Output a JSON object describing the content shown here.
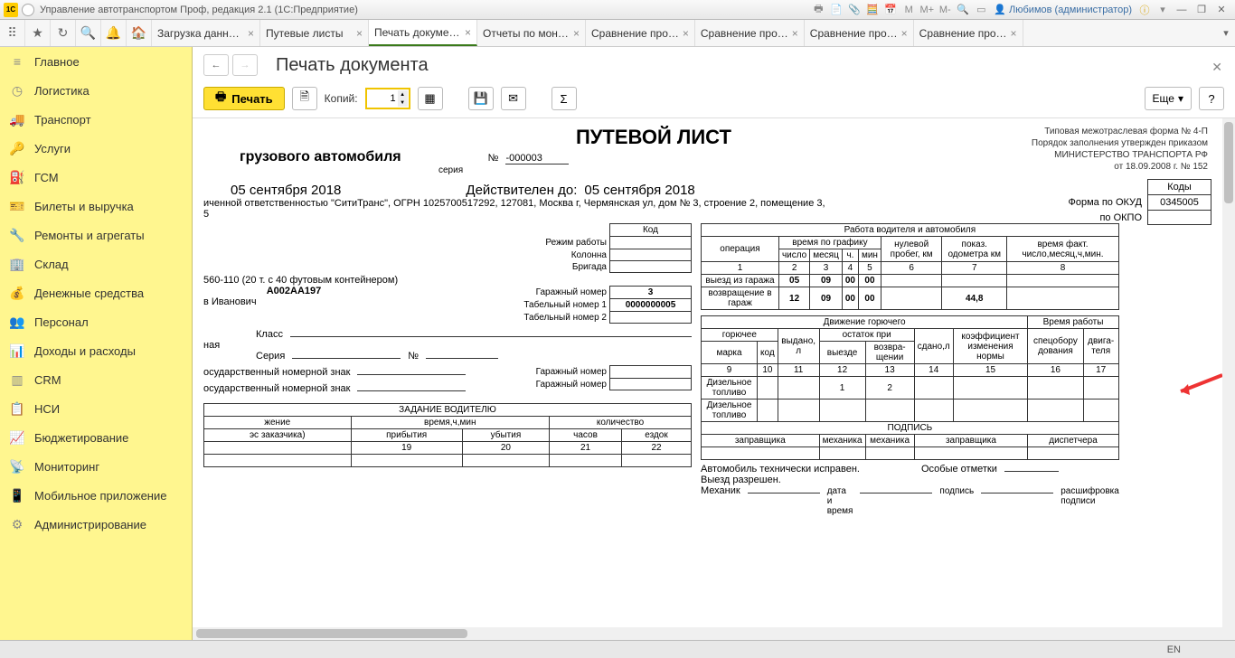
{
  "titlebar": {
    "title": "Управление автотранспортом Проф, редакция 2.1  (1С:Предприятие)",
    "user": "Любимов (администратор)"
  },
  "tabs": [
    {
      "label": "Загрузка данн…",
      "active": false
    },
    {
      "label": "Путевые листы",
      "active": false
    },
    {
      "label": "Печать докуме…",
      "active": true
    },
    {
      "label": "Отчеты по мон…",
      "active": false
    },
    {
      "label": "Сравнение про…",
      "active": false
    },
    {
      "label": "Сравнение про…",
      "active": false
    },
    {
      "label": "Сравнение про…",
      "active": false
    },
    {
      "label": "Сравнение про…",
      "active": false
    }
  ],
  "sidebar": [
    {
      "icon": "≡",
      "label": "Главное"
    },
    {
      "icon": "◷",
      "label": "Логистика"
    },
    {
      "icon": "🚚",
      "label": "Транспорт"
    },
    {
      "icon": "🔑",
      "label": "Услуги"
    },
    {
      "icon": "⛽",
      "label": "ГСМ"
    },
    {
      "icon": "🎫",
      "label": "Билеты и выручка"
    },
    {
      "icon": "🔧",
      "label": "Ремонты и агрегаты"
    },
    {
      "icon": "🏢",
      "label": "Склад"
    },
    {
      "icon": "💰",
      "label": "Денежные средства"
    },
    {
      "icon": "👥",
      "label": "Персонал"
    },
    {
      "icon": "📊",
      "label": "Доходы и расходы"
    },
    {
      "icon": "▥",
      "label": "CRM"
    },
    {
      "icon": "📋",
      "label": "НСИ"
    },
    {
      "icon": "📈",
      "label": "Бюджетирование"
    },
    {
      "icon": "📡",
      "label": "Мониторинг"
    },
    {
      "icon": "📱",
      "label": "Мобильное приложение"
    },
    {
      "icon": "⚙",
      "label": "Администрирование"
    }
  ],
  "page": {
    "title": "Печать документа",
    "print": "Печать",
    "copies_label": "Копий:",
    "copies": "1",
    "more": "Еще",
    "help": "?"
  },
  "doc": {
    "t1": "ПУТЕВОЙ ЛИСТ",
    "t2": "грузового автомобиля",
    "series_lbl": "серия",
    "no_lbl": "№",
    "no": "-000003",
    "regnote1": "Типовая межотраслевая форма № 4-П",
    "regnote2": "Порядок заполнения утвержден приказом",
    "regnote3": "МИНИСТЕРСТВО ТРАНСПОРТА РФ",
    "regnote4": "от 18.09.2008 г. № 152",
    "date": "05 сентября 2018",
    "valid_lbl": "Действителен до:",
    "valid": "05 сентября 2018",
    "org": "иченной ответственностью \"СитиТранс\", ОГРН 1025700517292, 127081, Москва г, Чермянская ул, дом № 3, строение 2, помещение 3,",
    "org2": "5",
    "kody_lbl": "Коды",
    "okud_lbl": "Форма по ОКУД",
    "okud": "0345005",
    "okpo_lbl": "по ОКПО",
    "okpo": "",
    "kod_lbl": "Код",
    "rezhim": "Режим работы",
    "kolonna": "Колонна",
    "brigada": "Бригада",
    "vehicle": "560-110 (20 т. с 40 футовым контейнером)",
    "plate": "А002АА197",
    "driver": "в Иванович",
    "klass": "Класс",
    "seria": "Серия",
    "no2": "№",
    "garnum_lbl": "Гаражный номер",
    "garnum": "3",
    "tabnum1_lbl": "Табельный номер 1",
    "tabnum1": "0000000005",
    "tabnum2_lbl": "Табельный номер 2",
    "ext1": "ная",
    "gnz": "осударственный номерной знак",
    "work_header": "Работа водителя и автомобиля",
    "op": "операция",
    "vrg": "время по графику",
    "nul": "нулевой пробег, км",
    "odo": "показ. одометра км",
    "fact": "время факт. число,месяц,ч,мин.",
    "chislo": "число",
    "mesyac": "месяц",
    "ch": "ч.",
    "min": "мин",
    "r1": "1",
    "r2": "2",
    "r3": "3",
    "r4": "4",
    "r5": "5",
    "r6": "6",
    "r7": "7",
    "r8": "8",
    "vyezd": "выезд из гаража",
    "vozvr": "возвращение в гараж",
    "d05": "05",
    "d09": "09",
    "d00": "00",
    "d12": "12",
    "d448": "44,8",
    "fuel_header": "Движение горючего",
    "vrab": "Время работы",
    "goryuchee": "горючее",
    "vydano": "выдано, л",
    "ost": "остаток при",
    "sdano": "сдано,л",
    "koef": "коэффициент изменения нормы",
    "spec": "спецобору дования",
    "dvig": "двига- теля",
    "marka": "марка",
    "kod2": "код",
    "vyezde": "выезде",
    "vozvr2": "возвра- щении",
    "n9": "9",
    "n10": "10",
    "n11": "11",
    "n12": "12",
    "n13": "13",
    "n14": "14",
    "n15": "15",
    "n16": "16",
    "n17": "17",
    "diesel": "Дизельное топливо",
    "f1": "1",
    "f2": "2",
    "podpis": "ПОДПИСЬ",
    "zapr": "заправщика",
    "meh": "механика",
    "disp": "диспетчера",
    "task": "ЗАДАНИЕ ВОДИТЕЛЮ",
    "zhenie": "жение",
    "vrch": "время,ч,мин",
    "kolvo": "количество",
    "zakaz": "эс заказчика)",
    "prib": "прибытия",
    "uby": "убытия",
    "chasov": "часов",
    "ezdok": "ездок",
    "c19": "19",
    "c20": "20",
    "c21": "21",
    "c22": "22",
    "tech": "Автомобиль технически исправен.",
    "otm": "Особые отметки",
    "vyr": "Выезд разрешен.",
    "mex2": "Механик",
    "dv": "дата и время",
    "pod": "подпись",
    "rasp": "расшифровка подписи"
  },
  "status": {
    "lang": "EN"
  }
}
